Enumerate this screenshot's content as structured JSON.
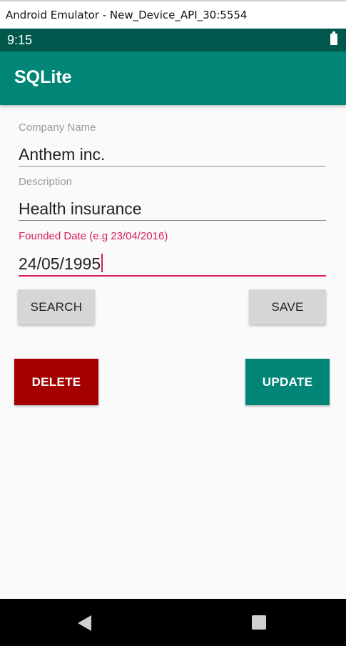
{
  "window": {
    "title": "Android Emulator - New_Device_API_30:5554"
  },
  "status_bar": {
    "time": "9:15",
    "icons": [
      "battery-icon"
    ]
  },
  "app_bar": {
    "title": "SQLite",
    "color": "#008577"
  },
  "form": {
    "company": {
      "label": "Company Name",
      "value": "Anthem inc."
    },
    "description": {
      "label": "Description",
      "value": "Health insurance"
    },
    "founded": {
      "label": "Founded Date (e.g 23/04/2016)",
      "value": "24/05/1995",
      "focused": true
    }
  },
  "buttons": {
    "search": "SEARCH",
    "save": "SAVE",
    "delete": "DELETE",
    "update": "UPDATE"
  },
  "colors": {
    "accent": "#d81b60",
    "primary": "#008577",
    "primary_dark": "#00574b",
    "delete": "#a40000"
  },
  "nav_bar": {
    "icons": [
      "back-icon",
      "recents-icon"
    ]
  }
}
